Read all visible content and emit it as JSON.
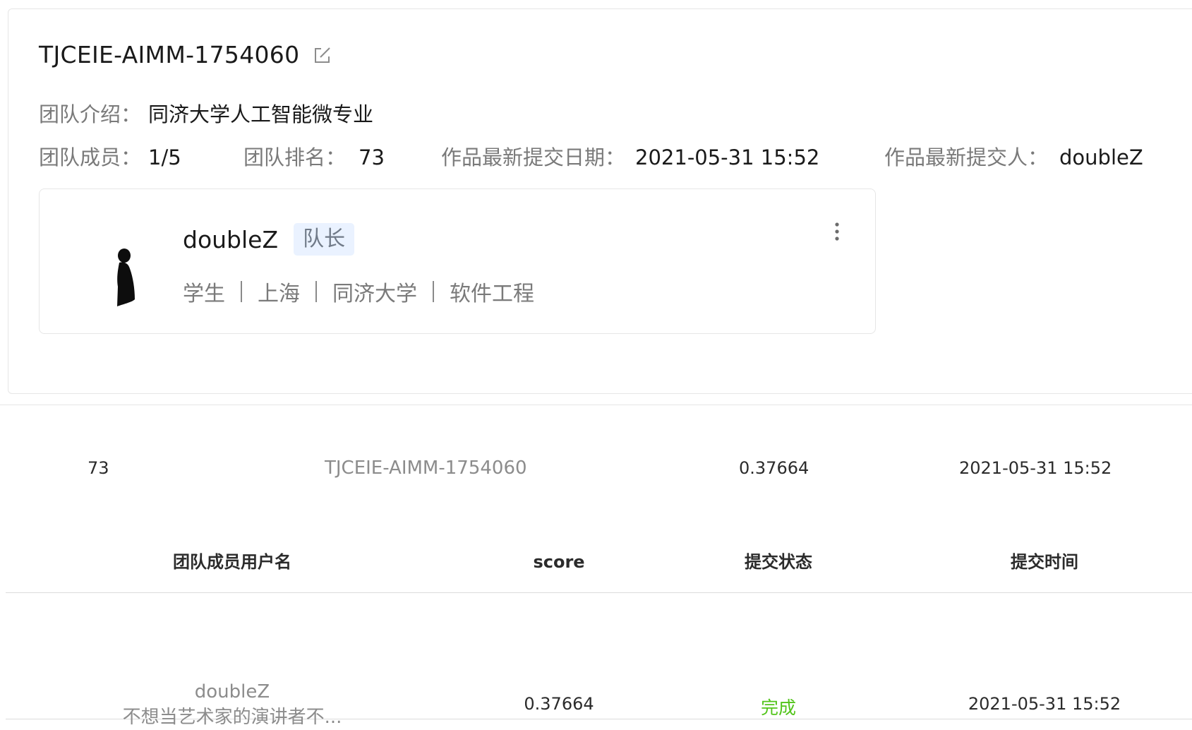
{
  "team": {
    "name": "TJCEIE-AIMM-1754060",
    "intro_label": "团队介绍：",
    "intro_value": "同济大学人工智能微专业",
    "members_label": "团队成员：",
    "members_value": "1/5",
    "rank_label": "团队排名：",
    "rank_value": "73",
    "latest_date_label": "作品最新提交日期：",
    "latest_date_value": "2021-05-31 15:52",
    "latest_submitter_label": "作品最新提交人：",
    "latest_submitter_value": "doubleZ"
  },
  "member_card": {
    "name": "doubleZ",
    "role": "队长",
    "identity": "学生",
    "city": "上海",
    "school": "同济大学",
    "major": "软件工程",
    "icons": [
      "avatar-silhouette-icon",
      "more-vertical-icon",
      "edit-icon"
    ]
  },
  "rank_row": {
    "rank": "73",
    "team_name": "TJCEIE-AIMM-1754060",
    "score": "0.37664",
    "time": "2021-05-31 15:52"
  },
  "members_table": {
    "columns": [
      "团队成员用户名",
      "score",
      "提交状态",
      "提交时间"
    ],
    "rows": [
      {
        "username": "doubleZ",
        "signature": "不想当艺术家的演讲者不...",
        "score": "0.37664",
        "status": "完成",
        "time": "2021-05-31 15:52"
      }
    ]
  },
  "colors": {
    "status_done": "#52c41a",
    "badge_bg": "#eaf2ff",
    "border": "#e6e6e6",
    "label_gray": "#7a7a7a"
  }
}
